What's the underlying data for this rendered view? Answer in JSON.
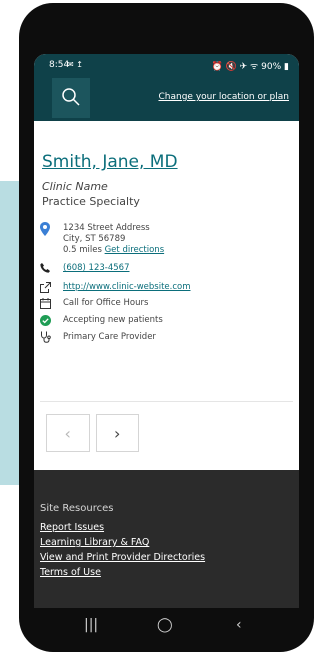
{
  "status_bar": {
    "time": "8:54",
    "left_icons": "✉ ↥",
    "right_icons": "⏰ 🔇 ✈ ᯤ",
    "battery_text": "90%"
  },
  "header": {
    "change_link": "Change your location or plan"
  },
  "provider": {
    "name": "Smith, Jane, MD",
    "clinic_name": "Clinic Name",
    "specialty": "Practice Specialty",
    "address_line1": "1234 Street Address",
    "address_line2": "City, ST 56789",
    "distance": "0.5 miles",
    "directions_label": "Get directions",
    "phone": "(608) 123-4567",
    "website": "http://www.clinic-website.com",
    "office_hours": "Call for Office Hours",
    "accepting": "Accepting new patients",
    "pcp": "Primary Care Provider"
  },
  "pager": {
    "prev": "‹",
    "next": "›"
  },
  "footer": {
    "title": "Site Resources",
    "links": [
      "Report Issues",
      "Learning Library & FAQ",
      "View and Print Provider Directories",
      "Terms of Use"
    ]
  },
  "navbar": {
    "recents": "|||",
    "home": "◯",
    "back": "‹"
  },
  "colors": {
    "header_bg": "#0f4149",
    "link": "#0b6e7b",
    "footer_bg": "#2b2b2b",
    "accent_panel": "#b9dde2",
    "accepting_check": "#1f9d55"
  }
}
